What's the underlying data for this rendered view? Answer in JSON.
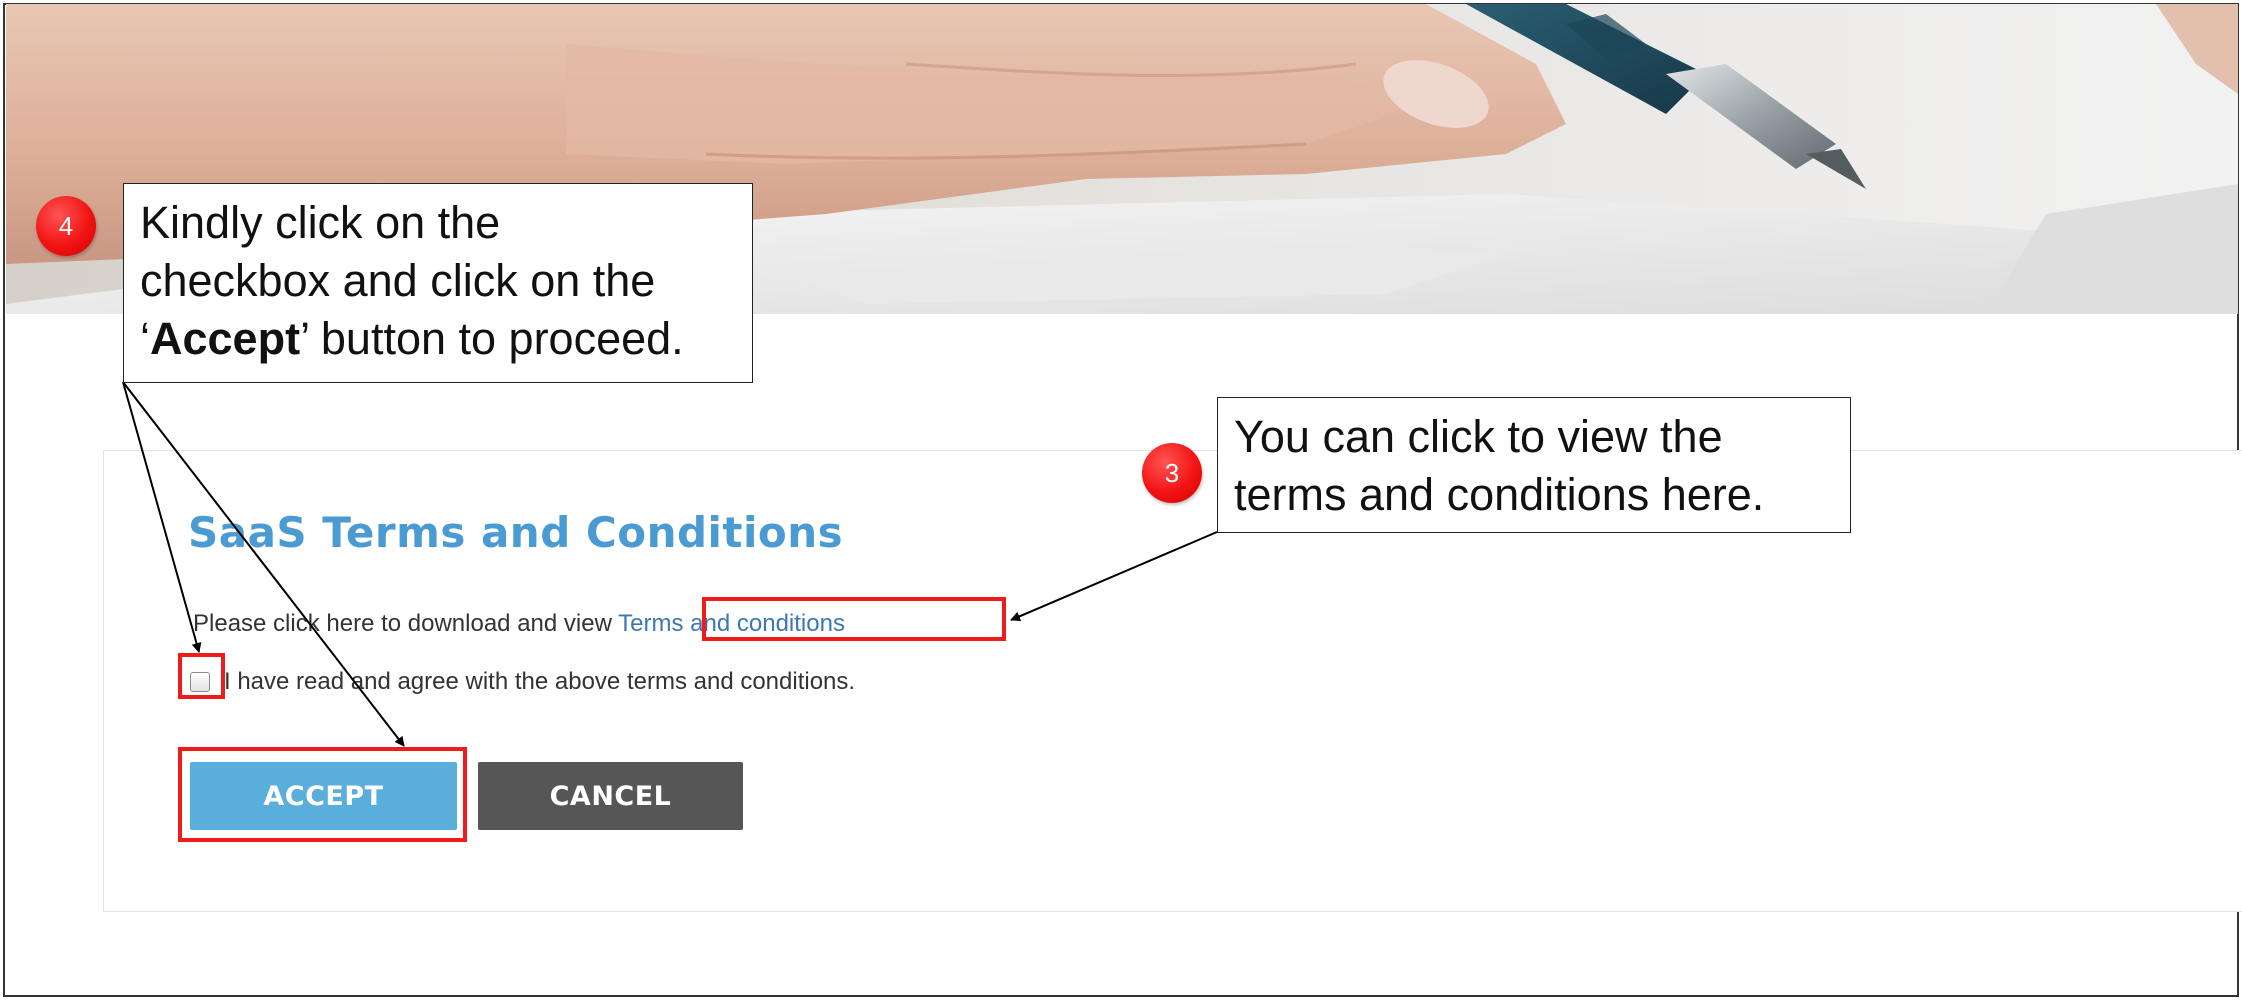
{
  "page": {
    "title": "SaaS Terms and Conditions",
    "download_prefix": "Please click here to download and view ",
    "terms_link": "Terms and conditions",
    "agree_label": "I have read and agree with the above terms and conditions.",
    "accept_label": "ACCEPT",
    "cancel_label": "CANCEL"
  },
  "annotations": {
    "step4": {
      "number": "4",
      "line1": "Kindly click on the",
      "line2": "checkbox and click on the",
      "line3_open": "‘",
      "line3_bold": "Accept",
      "line3_rest": "’ button to proceed."
    },
    "step3": {
      "number": "3",
      "line1": "You can click to view the",
      "line2": "terms and conditions here."
    }
  },
  "colors": {
    "title": "#4a9ad4",
    "link": "#3b77b4",
    "accept_button": "#5aaedc",
    "cancel_button": "#565656",
    "highlight": "#ef1c1c",
    "marker": "#f21414"
  },
  "icons": {
    "checkbox": "checkbox-unchecked-icon"
  }
}
